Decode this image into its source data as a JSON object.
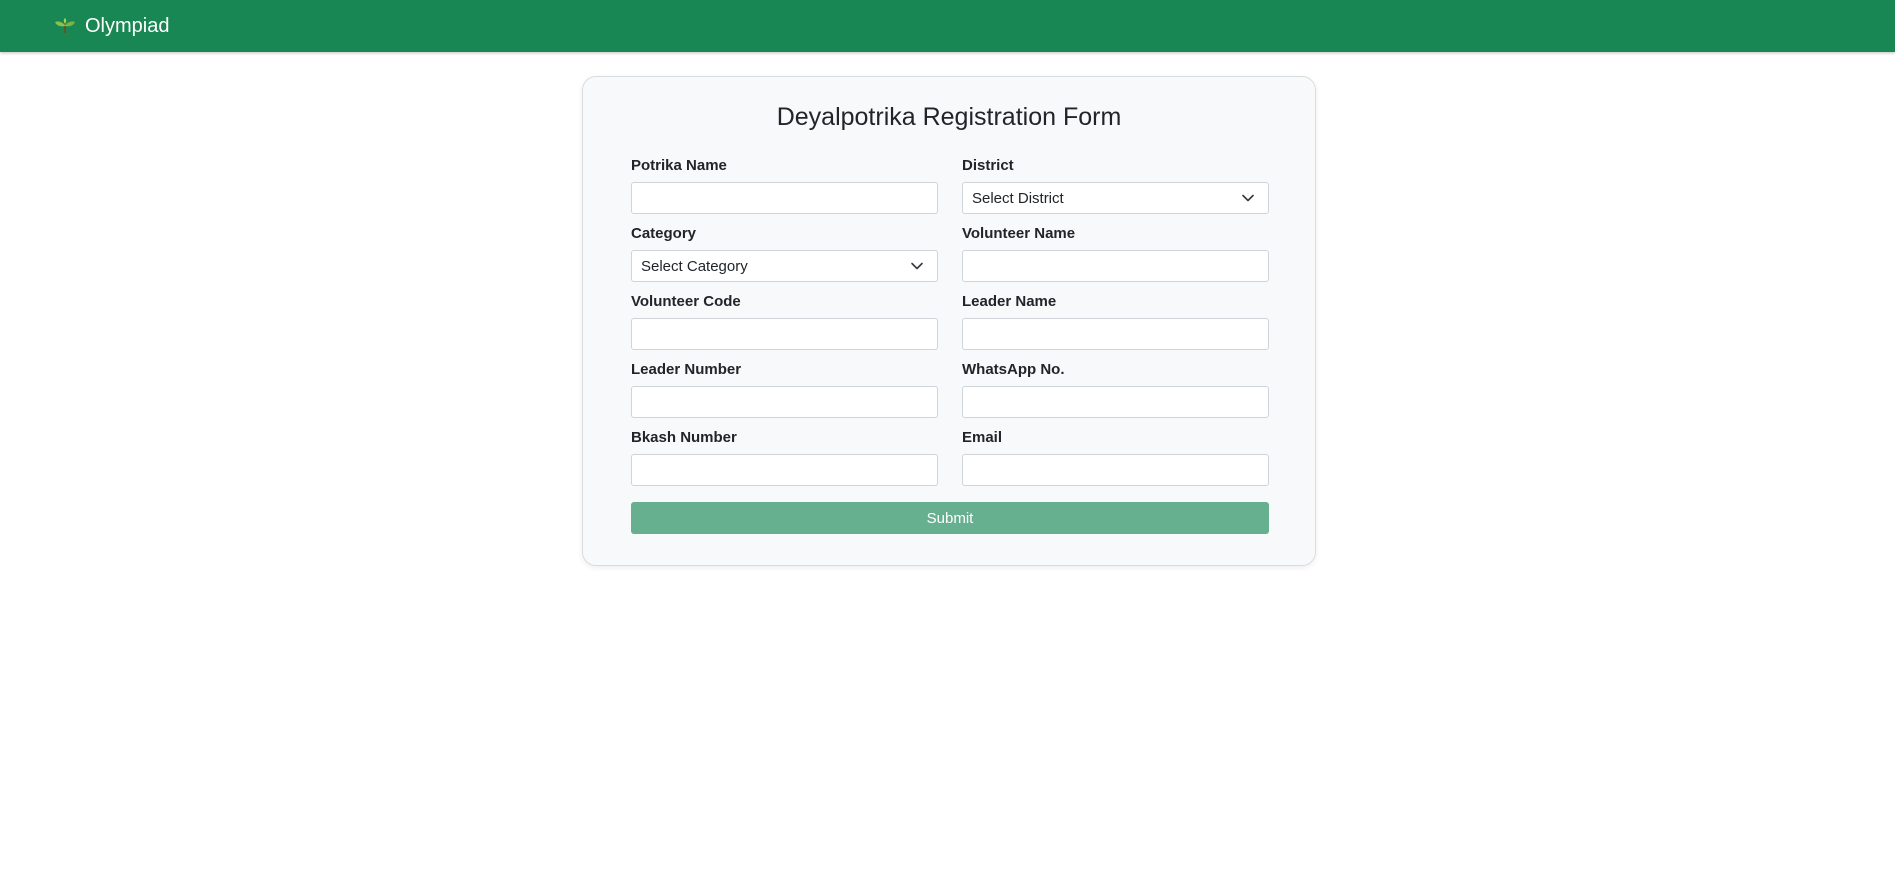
{
  "navbar": {
    "brand": "Olympiad",
    "logo_icon": "sprout-icon",
    "background": "#198754"
  },
  "form": {
    "title": "Deyalpotrika Registration Form",
    "fields": {
      "potrika_name": {
        "label": "Potrika Name",
        "value": ""
      },
      "district": {
        "label": "District",
        "selected": "Select District"
      },
      "category": {
        "label": "Category",
        "selected": "Select Category"
      },
      "volunteer_name": {
        "label": "Volunteer Name",
        "value": ""
      },
      "volunteer_code": {
        "label": "Volunteer Code",
        "value": ""
      },
      "leader_name": {
        "label": "Leader Name",
        "value": ""
      },
      "leader_number": {
        "label": "Leader Number",
        "value": ""
      },
      "whatsapp": {
        "label": "WhatsApp No.",
        "value": ""
      },
      "bkash_number": {
        "label": "Bkash Number",
        "value": ""
      },
      "email": {
        "label": "Email",
        "value": ""
      }
    },
    "submit_label": "Submit",
    "submit_color": "#66b08f"
  }
}
